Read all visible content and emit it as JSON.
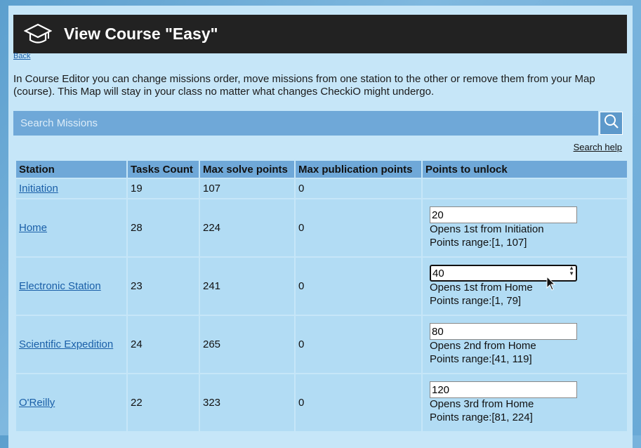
{
  "header": {
    "title": "View Course \"Easy\""
  },
  "nav": {
    "back_label": "Back"
  },
  "description": "In Course Editor you can change missions order, move missions from one station to the other or remove them from your Map (course). This Map will stay in your class no matter what changes CheckiO might undergo.",
  "search": {
    "placeholder": "Search Missions",
    "help_label": "Search help"
  },
  "table": {
    "headers": [
      "Station",
      "Tasks Count",
      "Max solve points",
      "Max publication points",
      "Points to unlock"
    ],
    "rows": [
      {
        "station": "Initiation",
        "tasks": "19",
        "solve": "107",
        "publication": "0"
      },
      {
        "station": "Home",
        "tasks": "28",
        "solve": "224",
        "publication": "0",
        "unlock_value": "20",
        "opens": "Opens 1st from Initiation",
        "range": "Points range:[1, 107]"
      },
      {
        "station": "Electronic Station",
        "tasks": "23",
        "solve": "241",
        "publication": "0",
        "unlock_value": "40",
        "opens": "Opens 1st from Home",
        "range": "Points range:[1, 79]"
      },
      {
        "station": "Scientific Expedition",
        "tasks": "24",
        "solve": "265",
        "publication": "0",
        "unlock_value": "80",
        "opens": "Opens 2nd from Home",
        "range": "Points range:[41, 119]"
      },
      {
        "station": "O'Reilly",
        "tasks": "22",
        "solve": "323",
        "publication": "0",
        "unlock_value": "120",
        "opens": "Opens 3rd from Home",
        "range": "Points range:[81, 224]"
      }
    ]
  }
}
